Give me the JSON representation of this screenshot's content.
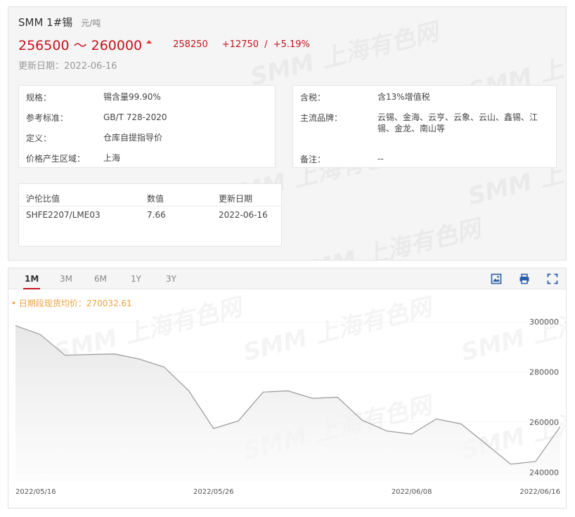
{
  "product": {
    "name": "SMM 1#锡",
    "unit": "元/吨",
    "price_range": "256500 ～ 260000",
    "average": "258250",
    "change": "+12750",
    "separator": "/",
    "change_pct": "+5.19%",
    "update_date": "更新日期：2022-06-16"
  },
  "watermark": "SMM 上海有色网",
  "specs_left": [
    {
      "key": "规格：",
      "value": "锡含量99.90%"
    },
    {
      "key": "参考标准：",
      "value": "GB/T 728-2020"
    },
    {
      "key": "定义：",
      "value": "仓库自提指导价"
    },
    {
      "key": "价格产生区域：",
      "value": "上海"
    }
  ],
  "specs_right": [
    {
      "key": "含税：",
      "value": "含13%增值税"
    },
    {
      "key": "主流品牌：",
      "value": "云锡、金海、云亨、云象、云山、鑫锡、江锡、金龙、南山等"
    },
    {
      "key": "备注：",
      "value": "--"
    }
  ],
  "ratio_table": {
    "headers": [
      "沪伦比值",
      "数值",
      "更新日期"
    ],
    "row": [
      "SHFE2207/LME03",
      "7.66",
      "2022-06-16"
    ]
  },
  "tabs": [
    "1M",
    "3M",
    "6M",
    "1Y",
    "3Y"
  ],
  "active_tab": "1M",
  "tools": [
    "image-download-icon",
    "print-icon",
    "fullscreen-icon"
  ],
  "average_label": "• 日期段现货均价：270032.61",
  "colors": {
    "accent": "#c4121f",
    "avg_label": "#f0a03c",
    "line": "#999999"
  },
  "chart_data": {
    "type": "area",
    "x": [
      "2022-05-16",
      "2022-05-17",
      "2022-05-18",
      "2022-05-19",
      "2022-05-20",
      "2022-05-23",
      "2022-05-24",
      "2022-05-25",
      "2022-05-26",
      "2022-05-27",
      "2022-05-30",
      "2022-05-31",
      "2022-06-01",
      "2022-06-02",
      "2022-06-06",
      "2022-06-07",
      "2022-06-08",
      "2022-06-09",
      "2022-06-10",
      "2022-06-13",
      "2022-06-14",
      "2022-06-15",
      "2022-06-16"
    ],
    "values": [
      298500,
      295000,
      286700,
      287000,
      287200,
      285200,
      282000,
      272500,
      257500,
      260500,
      272000,
      272500,
      269500,
      270000,
      260800,
      256500,
      255300,
      261300,
      259300,
      251300,
      243300,
      244300,
      258250
    ],
    "x_tick_labels": [
      "2022/05/16",
      "2022/05/26",
      "2022/06/08",
      "2022/06/16"
    ],
    "x_tick_index": [
      0,
      8,
      16,
      22
    ],
    "y_ticks": [
      240000,
      260000,
      280000,
      300000
    ],
    "ylim": [
      236500,
      310700
    ]
  }
}
